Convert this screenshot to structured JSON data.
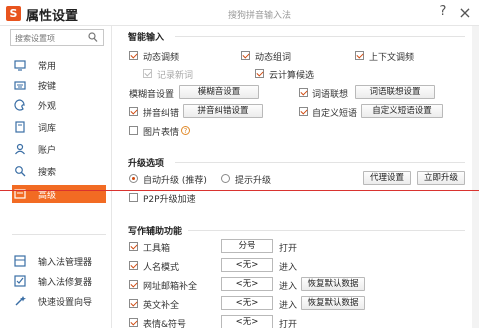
{
  "window": {
    "title": "属性设置",
    "subtitle": "搜狗拼音输入法",
    "help": "?",
    "close": "×"
  },
  "sidebar": {
    "search_placeholder": "搜索设置项",
    "items": [
      {
        "label": "常用",
        "icon": "monitor-icon"
      },
      {
        "label": "按键",
        "icon": "keyboard-icon"
      },
      {
        "label": "外观",
        "icon": "palette-icon"
      },
      {
        "label": "词库",
        "icon": "book-icon"
      },
      {
        "label": "账户",
        "icon": "user-icon"
      },
      {
        "label": "搜索",
        "icon": "search-icon"
      },
      {
        "label": "高级",
        "icon": "advanced-icon",
        "active": true
      }
    ],
    "bottom_items": [
      {
        "label": "输入法管理器",
        "icon": "ime-manager-icon"
      },
      {
        "label": "输入法修复器",
        "icon": "ime-repair-icon"
      },
      {
        "label": "快速设置向导",
        "icon": "wizard-icon"
      }
    ]
  },
  "smart_input": {
    "title": "智能输入",
    "dynamic_freq": {
      "label": "动态调频",
      "checked": true
    },
    "dynamic_group": {
      "label": "动态组词",
      "checked": true
    },
    "context_freq": {
      "label": "上下文调频",
      "checked": true
    },
    "record_new": {
      "label": "记录新词",
      "checked": true,
      "disabled": true
    },
    "cloud_candidates": {
      "label": "云计算候选",
      "checked": true
    },
    "fuzzy": {
      "label": "模糊音设置",
      "button": "模糊音设置"
    },
    "association": {
      "label": "词语联想",
      "checked": true,
      "button": "词语联想设置"
    },
    "pinyin_correct": {
      "label": "拼音纠错",
      "checked": true,
      "button": "拼音纠错设置"
    },
    "custom_phrase": {
      "label": "自定义短语",
      "checked": true,
      "button": "自定义短语设置"
    },
    "picture_emoji": {
      "label": "图片表情",
      "checked": false
    }
  },
  "upgrade": {
    "title": "升级选项",
    "auto": {
      "label": "自动升级 (推荐)",
      "selected": true
    },
    "prompt": {
      "label": "提示升级",
      "selected": false
    },
    "proxy_button": "代理设置",
    "upgrade_now_button": "立即升级",
    "p2p": {
      "label": "P2P升级加速",
      "checked": false
    }
  },
  "writing": {
    "title": "写作辅助功能",
    "rows": [
      {
        "label": "工具箱",
        "checked": true,
        "key": "分号",
        "action": "打开",
        "button": ""
      },
      {
        "label": "人名模式",
        "checked": true,
        "key": "<无>",
        "action": "进入",
        "button": ""
      },
      {
        "label": "网址邮箱补全",
        "checked": true,
        "key": "<无>",
        "action": "进入",
        "button": "恢复默认数据"
      },
      {
        "label": "英文补全",
        "checked": true,
        "key": "<无>",
        "action": "进入",
        "button": "恢复默认数据"
      },
      {
        "label": "表情&符号",
        "checked": true,
        "key": "<无>",
        "action": "打开",
        "button": ""
      }
    ]
  },
  "colors": {
    "accent": "#f26b23",
    "logo": "#e8541e",
    "annotation_line": "#d9332f"
  }
}
